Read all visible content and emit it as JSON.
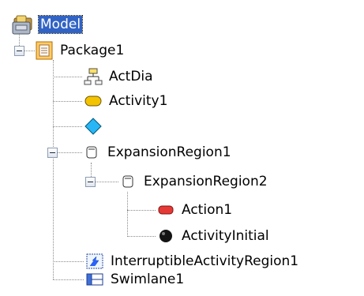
{
  "tree": {
    "root": {
      "label": "Model",
      "icon": "model-icon",
      "selected": true
    },
    "package1": {
      "label": "Package1",
      "icon": "package-icon",
      "expanded": true
    },
    "actdia": {
      "label": "ActDia",
      "icon": "activity-diagram-icon"
    },
    "activity1": {
      "label": "Activity1",
      "icon": "activity-icon"
    },
    "decision": {
      "label": "",
      "icon": "decision-node-icon"
    },
    "expansionregion1": {
      "label": "ExpansionRegion1",
      "icon": "expansion-region-icon",
      "expanded": true
    },
    "expansionregion2": {
      "label": "ExpansionRegion2",
      "icon": "expansion-region-icon",
      "expanded": true
    },
    "action1": {
      "label": "Action1",
      "icon": "action-icon"
    },
    "activityinitial": {
      "label": "ActivityInitial",
      "icon": "initial-node-icon"
    },
    "interruptible": {
      "label": "InterruptibleActivityRegion1",
      "icon": "interruptible-region-icon"
    },
    "swimlane1": {
      "label": "Swimlane1",
      "icon": "swimlane-icon"
    }
  },
  "colors": {
    "selection": "#3163c5",
    "tree_lines": "#8a8a8a",
    "action": "#e53935",
    "decision": "#29b6f6",
    "activity": "#f3c300"
  }
}
